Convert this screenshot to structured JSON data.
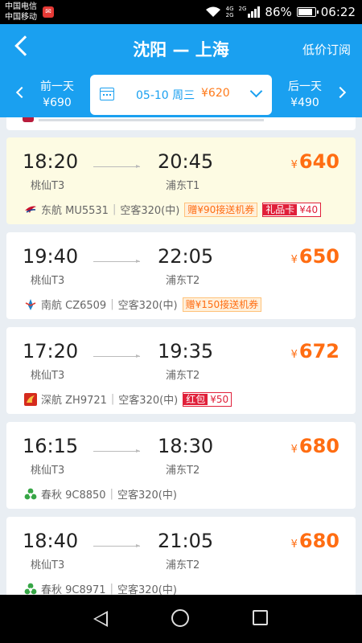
{
  "status_bar": {
    "carrier1": "中国电信",
    "carrier2": "中国移动",
    "net_top": "4G",
    "net_bottom": "2G",
    "net2": "2G",
    "battery": "86%",
    "time": "06:22"
  },
  "header": {
    "title": "沈阳 — 上海",
    "subscribe_label": "低价订阅"
  },
  "date_bar": {
    "prev_label": "前一天",
    "prev_price": "¥690",
    "current_date": "05-10 周三",
    "current_price": "¥620",
    "next_label": "后一天",
    "next_price": "¥490"
  },
  "flights": [
    {
      "dep_time": "18:20",
      "dep_terminal": "桃仙T3",
      "arr_time": "20:45",
      "arr_terminal": "浦东T1",
      "price": "640",
      "airline": "东航 MU5531",
      "aircraft": "空客320(中)",
      "tags": [
        {
          "style": "ora",
          "lead": "",
          "text": "赠¥90接送机券"
        },
        {
          "style": "red",
          "lead": "礼品卡",
          "text": "¥40"
        }
      ],
      "logo": "china-eastern",
      "highlight": true
    },
    {
      "dep_time": "19:40",
      "dep_terminal": "桃仙T3",
      "arr_time": "22:05",
      "arr_terminal": "浦东T2",
      "price": "650",
      "airline": "南航 CZ6509",
      "aircraft": "空客320(中)",
      "tags": [
        {
          "style": "ora",
          "lead": "",
          "text": "赠¥150接送机券"
        }
      ],
      "logo": "china-southern",
      "highlight": false
    },
    {
      "dep_time": "17:20",
      "dep_terminal": "桃仙T3",
      "arr_time": "19:35",
      "arr_terminal": "浦东T2",
      "price": "672",
      "airline": "深航 ZH9721",
      "aircraft": "空客320(中)",
      "tags": [
        {
          "style": "red",
          "lead": "红包",
          "text": "¥50"
        }
      ],
      "logo": "shenzhen",
      "highlight": false
    },
    {
      "dep_time": "16:15",
      "dep_terminal": "桃仙T3",
      "arr_time": "18:30",
      "arr_terminal": "浦东T2",
      "price": "680",
      "airline": "春秋 9C8850",
      "aircraft": "空客320(中)",
      "tags": [],
      "logo": "spring",
      "highlight": false
    },
    {
      "dep_time": "18:40",
      "dep_terminal": "桃仙T3",
      "arr_time": "21:05",
      "arr_terminal": "浦东T2",
      "price": "680",
      "airline": "春秋 9C8971",
      "aircraft": "空客320(中)",
      "tags": [],
      "logo": "spring",
      "highlight": false
    }
  ],
  "currency_symbol": "¥",
  "meta_separator": "|",
  "colors": {
    "header_bg": "#1aa0f0",
    "price": "#ff6d12",
    "highlight_card": "#fdfbe3"
  }
}
